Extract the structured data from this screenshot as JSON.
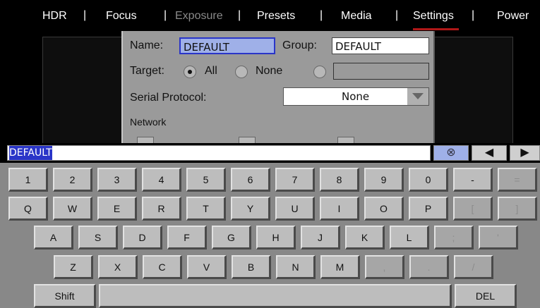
{
  "menu": {
    "items": [
      "HDR",
      "Focus",
      "Exposure",
      "Presets",
      "Media",
      "Settings",
      "Power"
    ],
    "separator": "|",
    "active": "Settings",
    "disabled": "Exposure"
  },
  "dialog": {
    "name_label": "Name:",
    "name_value": "DEFAULT",
    "group_label": "Group:",
    "group_value": "DEFAULT",
    "target_label": "Target:",
    "target_options": [
      "All",
      "None",
      ""
    ],
    "target_selected": "All",
    "serial_label": "Serial Protocol:",
    "serial_value": "None",
    "network_label": "Network"
  },
  "input": {
    "value": "DEFAULT",
    "clear_icon": "⊗",
    "left_icon": "◀",
    "right_icon": "▶"
  },
  "keyboard": {
    "row1": [
      "1",
      "2",
      "3",
      "4",
      "5",
      "6",
      "7",
      "8",
      "9",
      "0",
      "-",
      "="
    ],
    "row2": [
      "Q",
      "W",
      "E",
      "R",
      "T",
      "Y",
      "U",
      "I",
      "O",
      "P",
      "[",
      "]"
    ],
    "row3": [
      "A",
      "S",
      "D",
      "F",
      "G",
      "H",
      "J",
      "K",
      "L",
      ";",
      "'"
    ],
    "row4": [
      "Z",
      "X",
      "C",
      "V",
      "B",
      "N",
      "M",
      ",",
      ".",
      "/"
    ],
    "shift": "Shift",
    "space": "",
    "del": "DEL"
  },
  "colors": {
    "active_underline": "#b01818",
    "selection_highlight": "#2a35c8",
    "name_field_bg": "#9fb0e8"
  }
}
